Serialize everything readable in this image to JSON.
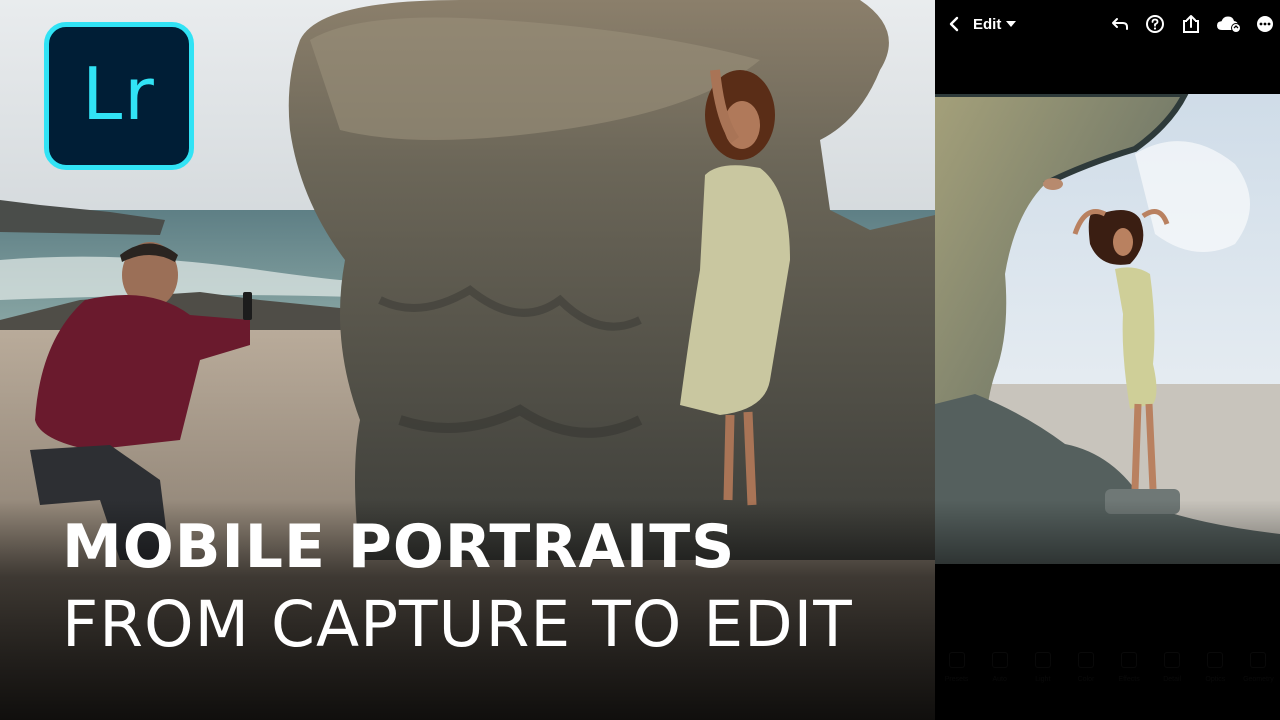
{
  "logo": {
    "text": "Lr",
    "icon": "lightroom-logo"
  },
  "headline": {
    "line1": "MOBILE PORTRAITS",
    "line2": "FROM CAPTURE TO EDIT"
  },
  "app": {
    "edit_menu": "Edit",
    "toolbar_icons": [
      "back-chevron-icon",
      "undo-icon",
      "help-icon",
      "share-icon",
      "cloud-sync-icon",
      "more-icon"
    ],
    "bottom_tools": [
      "Presets",
      "Auto",
      "Light",
      "Color",
      "Effects",
      "Detail",
      "Optics",
      "Geometry"
    ]
  },
  "colors": {
    "logo_accent": "#31e3f5",
    "logo_background": "#001e36",
    "app_background": "#000000"
  }
}
